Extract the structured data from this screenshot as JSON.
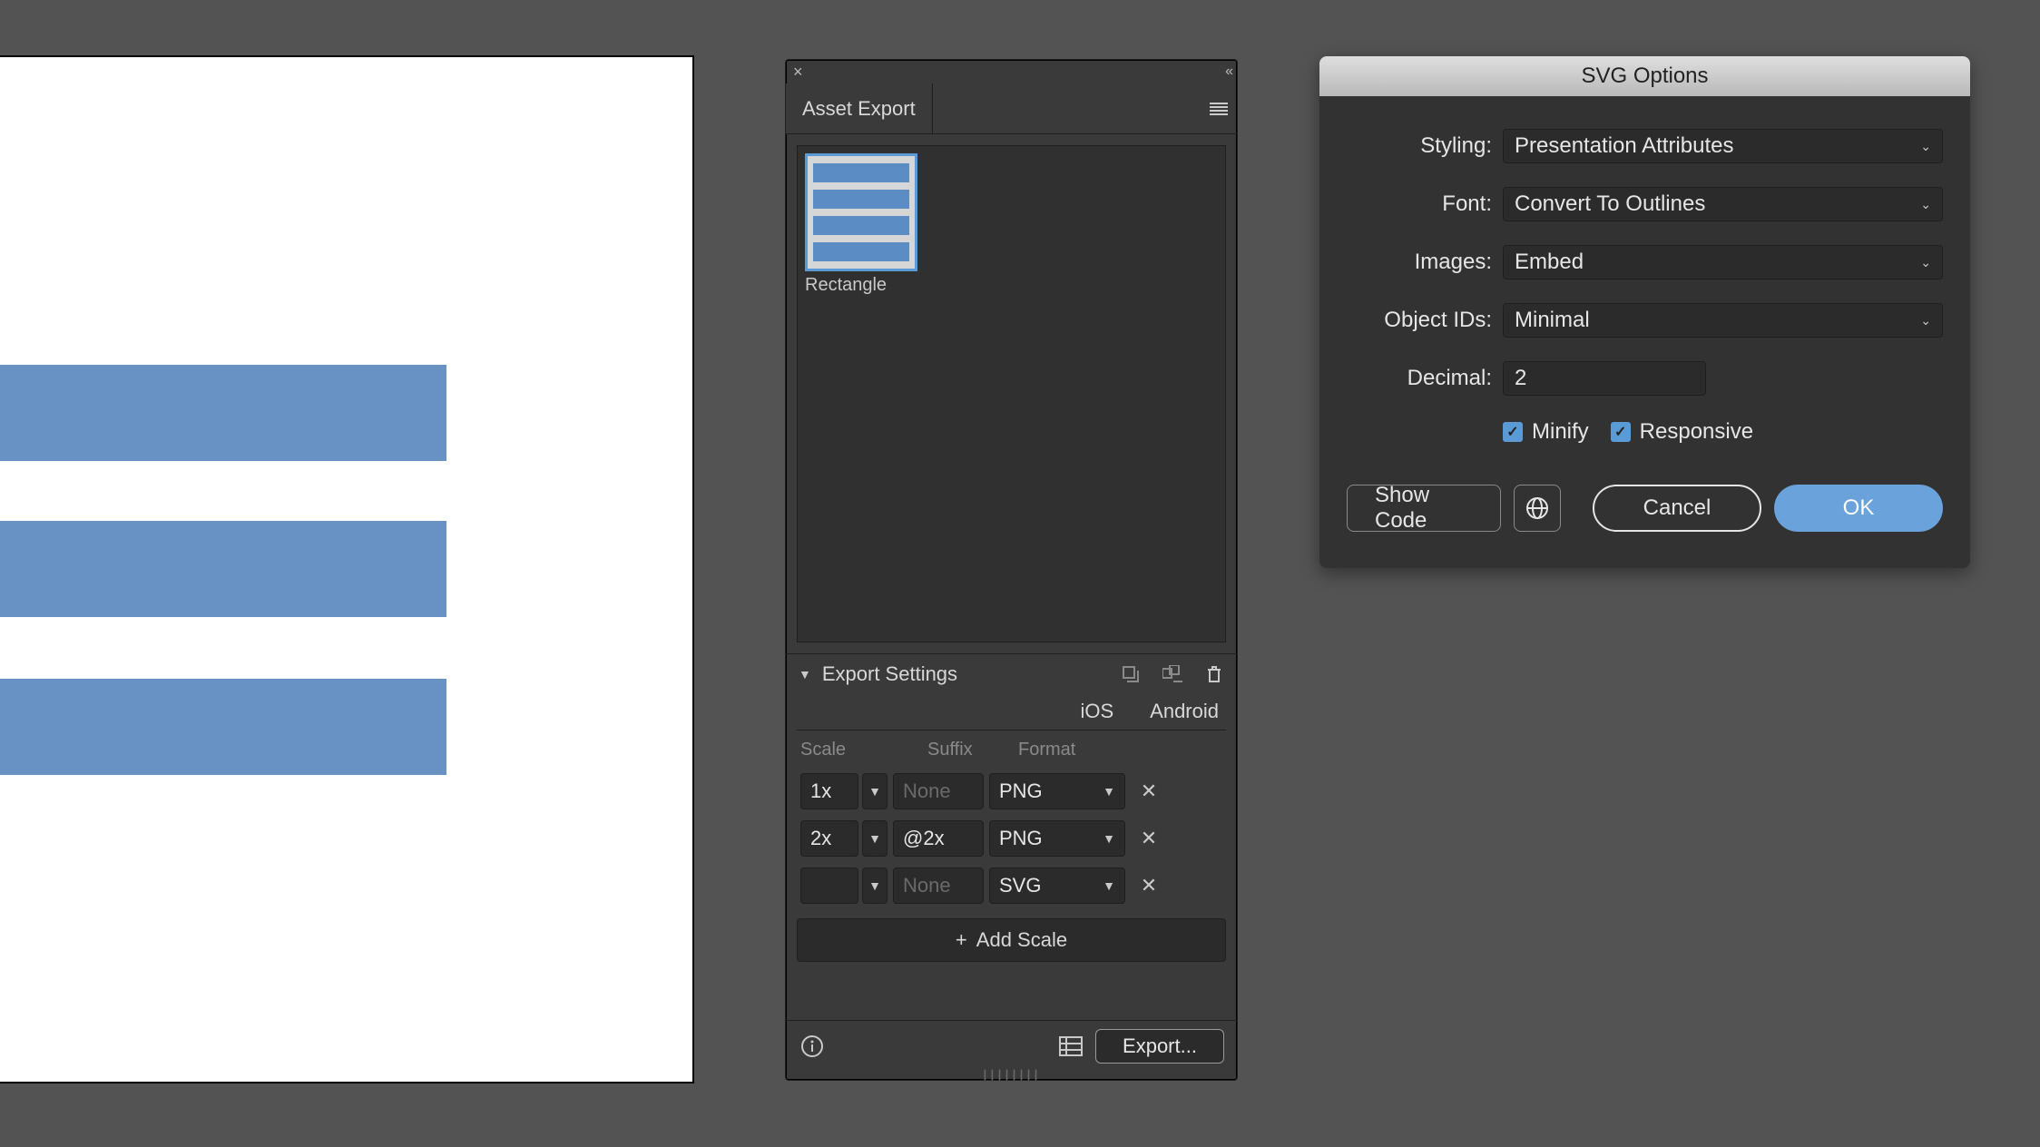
{
  "assetPanel": {
    "tab": "Asset Export",
    "asset": {
      "label": "Rectangle"
    },
    "exportSettings": "Export Settings",
    "platforms": {
      "ios": "iOS",
      "android": "Android"
    },
    "headers": {
      "scale": "Scale",
      "suffix": "Suffix",
      "format": "Format"
    },
    "rows": [
      {
        "scale": "1x",
        "suffix": "",
        "suffixPlaceholder": "None",
        "format": "PNG"
      },
      {
        "scale": "2x",
        "suffix": "@2x",
        "suffixPlaceholder": "",
        "format": "PNG"
      },
      {
        "scale": "",
        "suffix": "",
        "suffixPlaceholder": "None",
        "format": "SVG"
      }
    ],
    "addScale": "Add Scale",
    "exportBtn": "Export..."
  },
  "svgDialog": {
    "title": "SVG Options",
    "labels": {
      "styling": "Styling:",
      "font": "Font:",
      "images": "Images:",
      "objectIds": "Object IDs:",
      "decimal": "Decimal:"
    },
    "values": {
      "styling": "Presentation Attributes",
      "font": "Convert To Outlines",
      "images": "Embed",
      "objectIds": "Minimal",
      "decimal": "2"
    },
    "checks": {
      "minify": "Minify",
      "responsive": "Responsive"
    },
    "buttons": {
      "showCode": "Show Code",
      "cancel": "Cancel",
      "ok": "OK"
    }
  }
}
